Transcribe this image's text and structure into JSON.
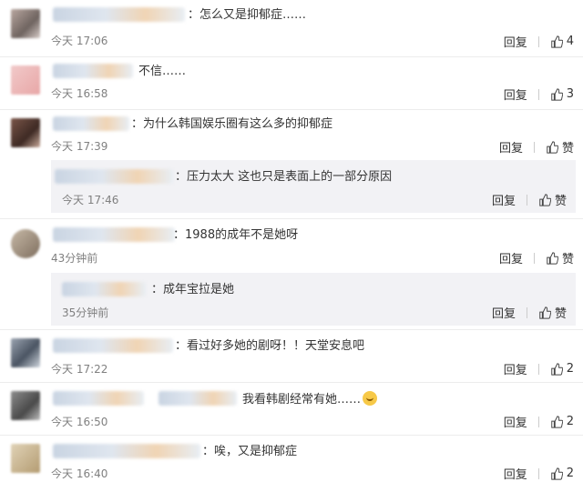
{
  "comments": [
    {
      "text": "：怎么又是抑郁症……",
      "time": "今天 17:06",
      "reply": "回复",
      "likes": "4"
    },
    {
      "text": "不信……",
      "time": "今天 16:58",
      "reply": "回复",
      "likes": "3"
    },
    {
      "text": "：为什么韩国娱乐圈有这么多的抑郁症",
      "time": "今天 17:39",
      "reply": "回复",
      "likes": "赞"
    },
    {
      "text": "：压力太大  这也只是表面上的一部分原因",
      "time": "今天 17:46",
      "reply": "回复",
      "likes": "赞"
    },
    {
      "text": "：1988的成年不是她呀",
      "time": "43分钟前",
      "reply": "回复",
      "likes": "赞"
    },
    {
      "text": "：成年宝拉是她",
      "time": "35分钟前",
      "reply": "回复",
      "likes": "赞"
    },
    {
      "text": "：看过好多她的剧呀！！天堂安息吧",
      "time": "今天 17:22",
      "reply": "回复",
      "likes": "2"
    },
    {
      "text": "我看韩剧经常有她……",
      "time": "今天 16:50",
      "reply": "回复",
      "likes": "2"
    },
    {
      "text": "：唉，又是抑郁症",
      "time": "今天 16:40",
      "reply": "回复",
      "likes": "2"
    }
  ]
}
